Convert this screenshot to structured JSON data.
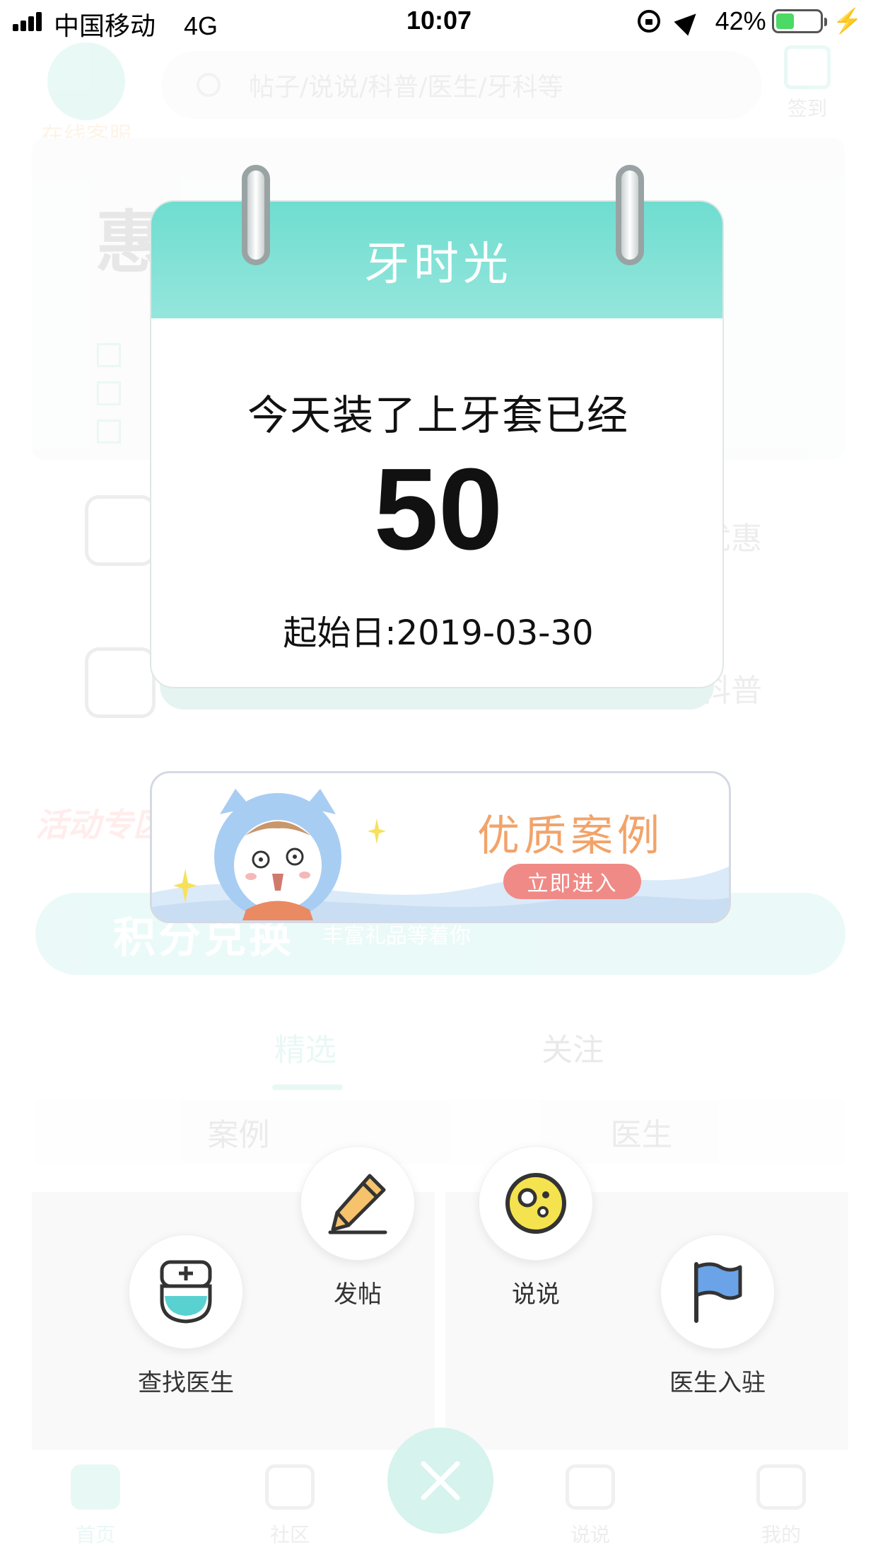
{
  "status_bar": {
    "carrier": "中国移动",
    "network": "4G",
    "time": "10:07",
    "battery_percent": "42%",
    "battery_level": 0.42
  },
  "background": {
    "customer_service_label": "在线客服",
    "search_placeholder": "帖子/说说/科普/医生/牙科等",
    "sign_in_label": "签到",
    "banner_title": "惠",
    "grid_label_right_1": "优惠",
    "grid_label_right_2": "科普",
    "activity_label": "活动专区",
    "points_title": "积分兑换",
    "points_subtitle": "丰富礼品等着你",
    "tabs": [
      "精选",
      "关注"
    ],
    "subtabs": [
      "案例",
      "医生"
    ],
    "nav": [
      "首页",
      "社区",
      "说说",
      "我的"
    ]
  },
  "calendar": {
    "title": "牙时光",
    "line1": "今天装了上牙套已经",
    "count": "50",
    "start_date": "起始日:2019-03-30"
  },
  "case_banner": {
    "title": "优质案例",
    "button": "立即进入"
  },
  "actions": {
    "find_doctor": "查找医生",
    "post": "发帖",
    "shuoshuo": "说说",
    "doctor_join": "医生入驻"
  },
  "colors": {
    "brand_teal": "#2bc4a7",
    "calendar_header": "#6fddd0",
    "case_title": "#f2a36a",
    "case_button": "#f08a86"
  }
}
